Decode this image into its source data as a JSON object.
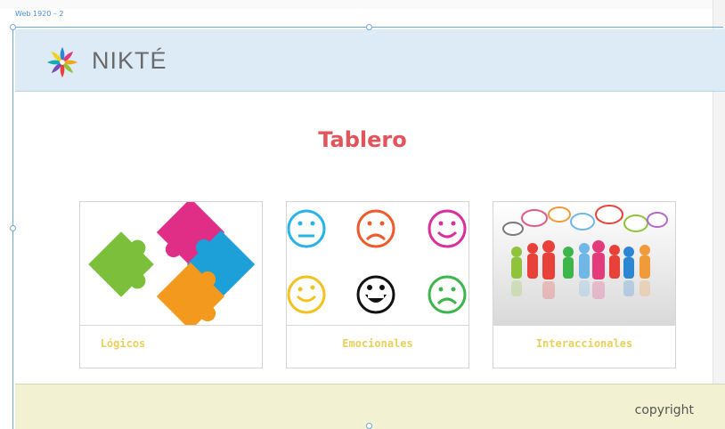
{
  "artboard": {
    "label": "Web 1920 – 2"
  },
  "header": {
    "brand": "NIKTÉ",
    "logo_icon": "flower-star-logo-icon"
  },
  "main": {
    "title": "Tablero",
    "title_color": "#e2545c",
    "cards": [
      {
        "label": "Lógicos",
        "icon": "puzzle-pieces-image"
      },
      {
        "label": "Emocionales",
        "icon": "emoji-faces-image"
      },
      {
        "label": "Interaccionales",
        "icon": "people-speech-bubbles-image"
      }
    ],
    "label_color": "#e7d15c"
  },
  "footer": {
    "copyright": "copyright",
    "background": "#f2f2d2"
  },
  "colors": {
    "header_bg": "#dcebf6",
    "selection_blue": "#6fa8dc"
  }
}
